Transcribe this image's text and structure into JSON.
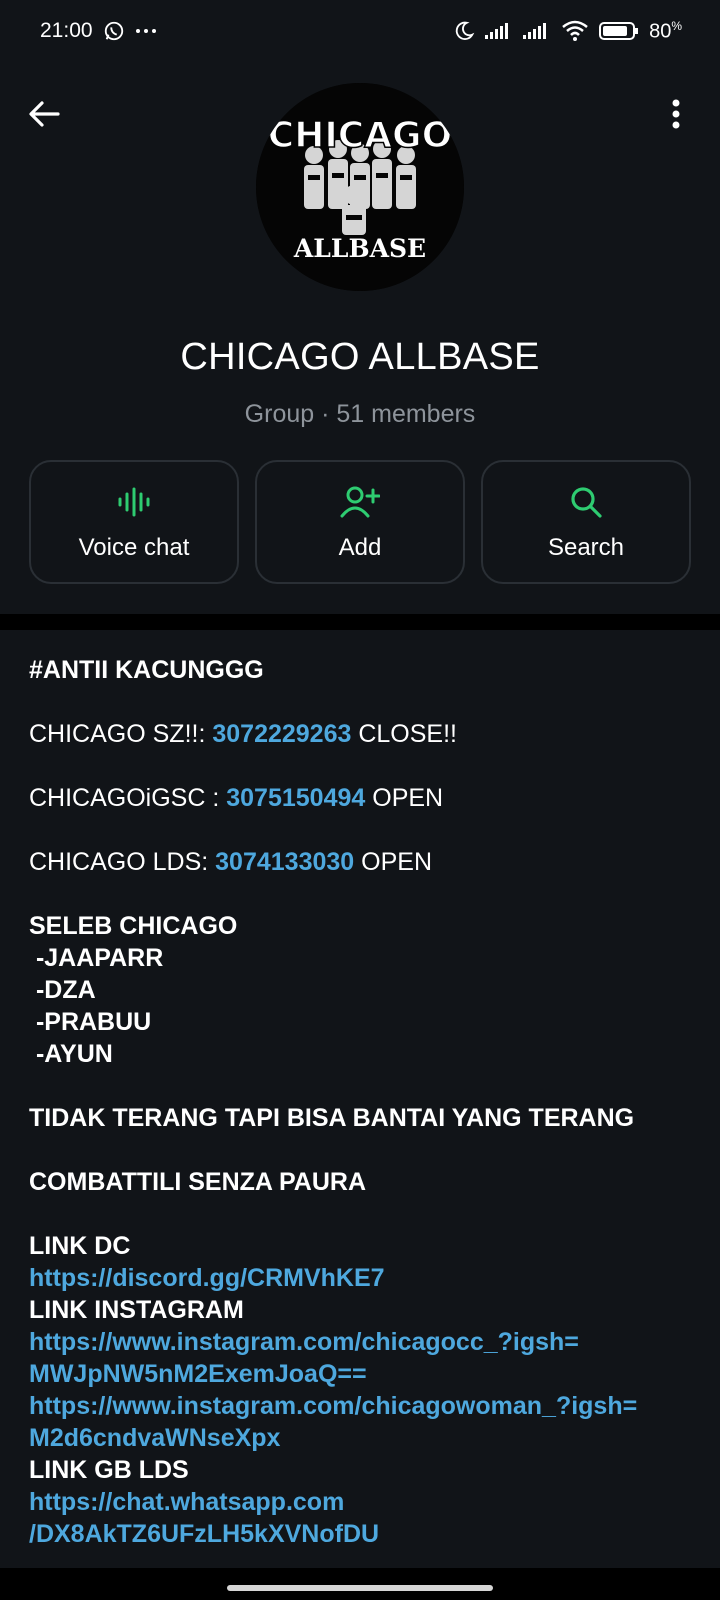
{
  "status_bar": {
    "time": "21:00",
    "battery": "80",
    "battery_unit": "%"
  },
  "header": {
    "title": "CHICAGO ALLBASE",
    "subtitle": "Group · 51 members",
    "avatar": {
      "logo_text_top": "CHICAGO",
      "logo_text_bottom": "ALLBASE"
    }
  },
  "actions": {
    "voice_chat": "Voice chat",
    "add": "Add",
    "search": "Search"
  },
  "colors": {
    "accent_green": "#2ecc71",
    "link_blue": "#4ea8de",
    "background": "#111418"
  },
  "description": {
    "hashtag": "#ANTII KACUNGGG",
    "line1_prefix": "CHICAGO SZ!!: ",
    "line1_number": "3072229263",
    "line1_suffix": " CLOSE!!",
    "line2_prefix": "CHICAGOiGSC : ",
    "line2_number": "3075150494",
    "line2_suffix": " OPEN",
    "line3_prefix": "CHICAGO LDS: ",
    "line3_number": "3074133030",
    "line3_suffix": " OPEN",
    "seleb_title": "SELEB CHICAGO",
    "seleb_1": " -JAAPARR",
    "seleb_2": " -DZA",
    "seleb_3": " -PRABUU",
    "seleb_4": " -AYUN",
    "tagline1": "TIDAK TERANG TAPI BISA BANTAI YANG TERANG",
    "tagline2": "COMBATTILI SENZA PAURA",
    "link_dc_label": "LINK DC",
    "link_dc": "https://discord.gg/CRMVhKE7",
    "link_ig_label": "LINK INSTAGRAM",
    "link_ig1_a": "https://www.instagram.com/chicagocc_?igsh=",
    "link_ig1_b": "MWJpNW5nM2ExemJoaQ==",
    "link_ig2_a": "https://www.instagram.com/chicagowoman_?igsh=",
    "link_ig2_b": "M2d6cndvaWNseXpx",
    "link_gb_label": "LINK GB LDS",
    "link_gb_a": "https://chat.whatsapp.com",
    "link_gb_b": "/DX8AkTZ6UFzLH5kXVNofDU"
  }
}
